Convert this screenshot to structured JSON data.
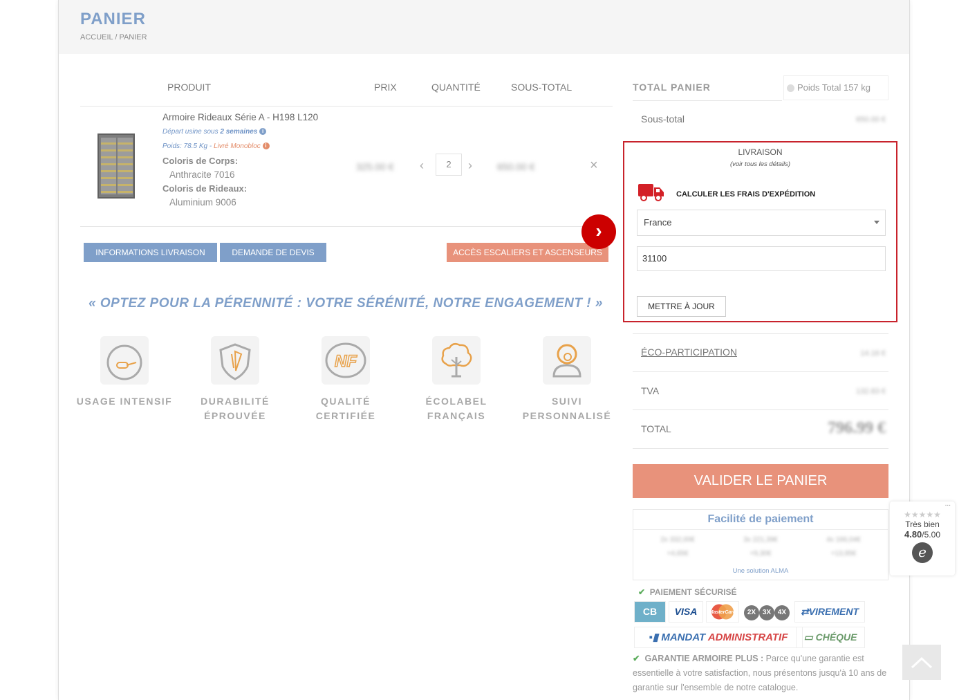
{
  "page": {
    "title": "PANIER",
    "breadcrumb": "ACCUEIL / PANIER"
  },
  "cart": {
    "columns": {
      "product": "PRODUIT",
      "price": "PRIX",
      "quantity": "QUANTITÉ",
      "subtotal": "SOUS-TOTAL"
    },
    "item": {
      "name": "Armoire Rideaux Série A - H198 L120",
      "departure_prefix": "Départ usine sous ",
      "departure_value": "2 semaines",
      "weight_text": "Poids: 78.5 Kg",
      "dash": " - ",
      "delivery_type": "Livré Monobloc",
      "attr1_label": "Coloris de Corps:",
      "attr1_value": "Anthracite 7016",
      "attr2_label": "Coloris de Rideaux:",
      "attr2_value": "Aluminium 9006",
      "price": "325.00 €",
      "quantity": "2",
      "subtotal": "650.00 €"
    },
    "buttons": {
      "delivery_info": "INFORMATIONS LIVRAISON",
      "quote": "DEMANDE DE DEVIS",
      "stairs": "ACCÈS ESCALIERS ET ASCENSEURS"
    }
  },
  "promo": {
    "slogan": "« OPTEZ POUR LA PÉRENNITÉ : VOTRE SÉRÉNITÉ, NOTRE ENGAGEMENT ! »",
    "features": [
      {
        "icon": "gauge-icon",
        "line1": "USAGE INTENSIF",
        "line2": ""
      },
      {
        "icon": "shield-icon",
        "line1": "DURABILITÉ",
        "line2": "ÉPROUVÉE"
      },
      {
        "icon": "nf-icon",
        "line1": "QUALITÉ",
        "line2": "CERTIFIÉE"
      },
      {
        "icon": "tree-icon",
        "line1": "ÉCOLABEL",
        "line2": "FRANÇAIS"
      },
      {
        "icon": "support-icon",
        "line1": "SUIVI",
        "line2": "PERSONNALISÉ"
      }
    ]
  },
  "totals": {
    "title": "TOTAL PANIER",
    "weight": "Poids Total 157 kg",
    "subtotal_label": "Sous-total",
    "subtotal_value": "650.00 €",
    "eco_label": "ÉCO-PARTICIPATION",
    "eco_value": "14.16 €",
    "tva_label": "TVA",
    "tva_value": "132.83 €",
    "total_label": "TOTAL",
    "total_value": "796.99 €",
    "validate": "VALIDER LE PANIER"
  },
  "shipping": {
    "title": "LIVRAISON",
    "subtitle": "(voir tous les détails)",
    "calc_label": "CALCULER LES FRAIS D'EXPÉDITION",
    "country": "France",
    "postcode": "31100",
    "update_button": "METTRE À JOUR"
  },
  "payment": {
    "facility_title": "Facilité de paiement",
    "options": [
      {
        "line1": "2x 332,00€",
        "line2": "+4,65€"
      },
      {
        "line1": "3x 221,39€",
        "line2": "+9,30€"
      },
      {
        "line1": "4x 166,04€",
        "line2": "+13,95€"
      }
    ],
    "alma": "Une solution ALMA",
    "secure_label": "PAIEMENT SÉCURISÉ",
    "methods": {
      "cb": "CB",
      "visa": "VISA",
      "mastercard": "MasterCard",
      "x2": "2X",
      "x3": "3X",
      "x4": "4X",
      "virement": "VIREMENT",
      "mandat1": "MANDAT",
      "mandat2": "ADMINISTRATIF",
      "cheque": "CHÉQUE"
    },
    "warranty_title": "GARANTIE ARMOIRE PLUS :",
    "warranty_text": " Parce qu'une garantie est essentielle à votre satisfaction, nous présentons jusqu'à 10 ans de garantie sur l'ensemble de notre catalogue."
  },
  "rating": {
    "label": "Très bien",
    "score": "4.80",
    "max": "/5.00",
    "stars": "★★★★★",
    "more": "...",
    "logo": "e"
  },
  "colors": {
    "accent_blue": "#7f9fc9",
    "salmon": "#e8927b",
    "red": "#c8232c"
  }
}
